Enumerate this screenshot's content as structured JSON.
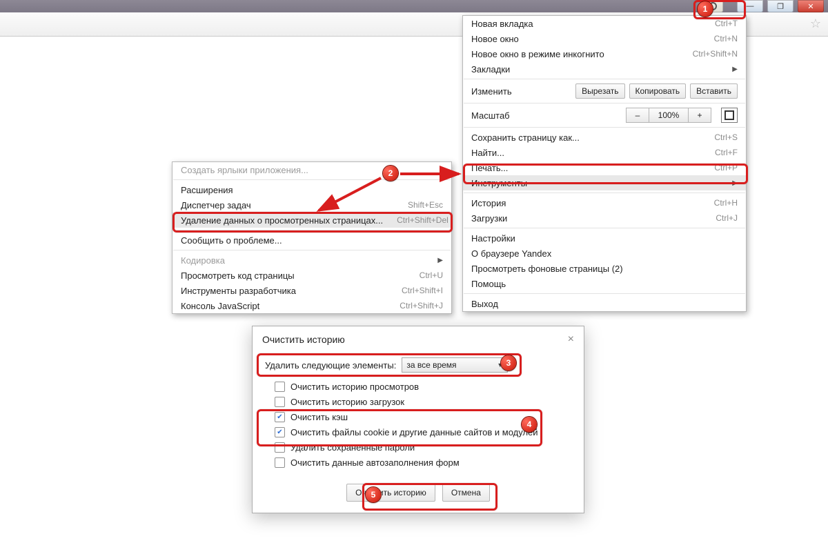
{
  "annotations": {
    "b1": "1",
    "b2": "2",
    "b3": "3",
    "b4": "4",
    "b5": "5"
  },
  "main_menu": {
    "new_tab": {
      "label": "Новая вкладка",
      "shortcut": "Ctrl+T"
    },
    "new_window": {
      "label": "Новое окно",
      "shortcut": "Ctrl+N"
    },
    "incognito": {
      "label": "Новое окно в режиме инкогнито",
      "shortcut": "Ctrl+Shift+N"
    },
    "bookmarks": {
      "label": "Закладки"
    },
    "edit": {
      "label": "Изменить",
      "cut": "Вырезать",
      "copy": "Копировать",
      "paste": "Вставить"
    },
    "zoom": {
      "label": "Масштаб",
      "value": "100%",
      "minus": "–",
      "plus": "+"
    },
    "save_page": {
      "label": "Сохранить страницу как...",
      "shortcut": "Ctrl+S"
    },
    "find": {
      "label": "Найти...",
      "shortcut": "Ctrl+F"
    },
    "print": {
      "label": "Печать...",
      "shortcut": "Ctrl+P"
    },
    "tools": {
      "label": "Инструменты"
    },
    "history": {
      "label": "История",
      "shortcut": "Ctrl+H"
    },
    "downloads": {
      "label": "Загрузки",
      "shortcut": "Ctrl+J"
    },
    "settings": {
      "label": "Настройки"
    },
    "about": {
      "label": "О браузере Yandex"
    },
    "bg_pages": {
      "label": "Просмотреть фоновые страницы (2)"
    },
    "help": {
      "label": "Помощь"
    },
    "exit": {
      "label": "Выход"
    }
  },
  "tools_menu": {
    "create_shortcuts": {
      "label": "Создать ярлыки приложения..."
    },
    "extensions": {
      "label": "Расширения"
    },
    "task_manager": {
      "label": "Диспетчер задач",
      "shortcut": "Shift+Esc"
    },
    "clear_data": {
      "label": "Удаление данных о просмотренных страницах...",
      "shortcut": "Ctrl+Shift+Del"
    },
    "report": {
      "label": "Сообщить о проблеме..."
    },
    "encoding": {
      "label": "Кодировка"
    },
    "view_source": {
      "label": "Просмотреть код страницы",
      "shortcut": "Ctrl+U"
    },
    "dev_tools": {
      "label": "Инструменты разработчика",
      "shortcut": "Ctrl+Shift+I"
    },
    "js_console": {
      "label": "Консоль JavaScript",
      "shortcut": "Ctrl+Shift+J"
    }
  },
  "dialog": {
    "title": "Очистить историю",
    "delete_label": "Удалить следующие элементы:",
    "range": "за все время",
    "opts": {
      "browsing": "Очистить историю просмотров",
      "downloads": "Очистить историю загрузок",
      "cache": "Очистить кэш",
      "cookies": "Очистить файлы cookie и другие данные сайтов и модулей",
      "passwords": "Удалить сохраненные пароли",
      "autofill": "Очистить данные автозаполнения форм"
    },
    "ok": "Очистить историю",
    "cancel": "Отмена"
  }
}
